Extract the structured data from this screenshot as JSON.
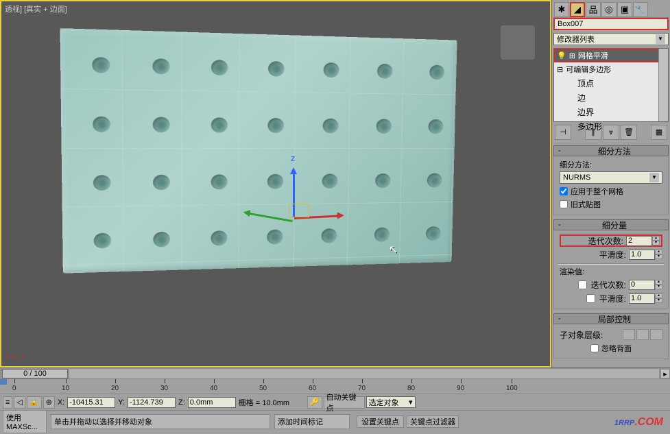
{
  "viewport": {
    "label": "透视] [真实 + 边面]"
  },
  "right_panel": {
    "object_name": "Box007",
    "modifier_dropdown": "修改器列表",
    "stack": {
      "items": [
        {
          "icon": "💡",
          "expand": "⊞",
          "label": "网格平滑",
          "selected": true
        },
        {
          "icon": "",
          "expand": "⊟",
          "label": "可编辑多边形",
          "selected": false
        }
      ],
      "subitems": [
        "顶点",
        "边",
        "边界",
        "多边形"
      ]
    },
    "rollout1": {
      "title": "细分方法",
      "method_label": "细分方法:",
      "method_value": "NURMS",
      "apply_whole": "应用于整个网格",
      "old_map": "旧式贴图"
    },
    "rollout2": {
      "title": "细分量",
      "iterations_label": "迭代次数:",
      "iterations_value": "2",
      "smoothness_label": "平滑度:",
      "smoothness_value": "1.0",
      "render_label": "渲染值:",
      "render_iter_label": "迭代次数:",
      "render_iter_value": "0",
      "render_smooth_label": "平滑度:",
      "render_smooth_value": "1.0"
    },
    "rollout3": {
      "title": "局部控制",
      "subobj_label": "子对象层级:",
      "ignore_back": "忽略背面"
    }
  },
  "time_slider": {
    "thumb": "0 / 100"
  },
  "ruler_ticks": [
    "0",
    "10",
    "20",
    "30",
    "40",
    "50",
    "60",
    "70",
    "80",
    "90",
    "100"
  ],
  "bottom_bar": {
    "x_value": "-10415.31",
    "y_value": "-1124.739",
    "z_value": "0.0mm",
    "grid_label": "栅格 = 10.0mm",
    "autokey": "自动关键点",
    "selected": "选定对象",
    "setkey": "设置关键点",
    "keyfilter": "关键点过滤器"
  },
  "status_bar": {
    "script": "使用  MAXSc...",
    "hint": "单击并拖动以选择并移动对象",
    "addtime": "添加时间标记"
  },
  "watermark": {
    "text": "1RRP",
    "com": ".COM"
  }
}
